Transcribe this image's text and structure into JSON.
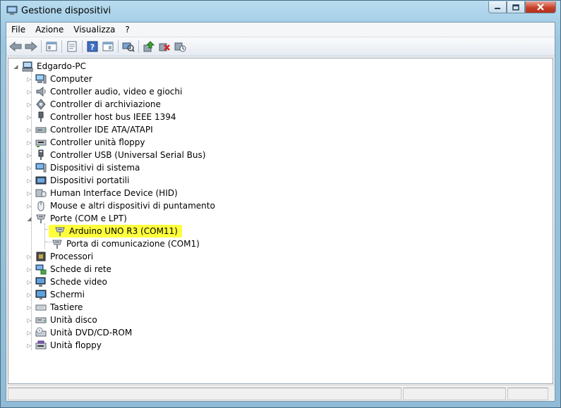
{
  "window": {
    "title": "Gestione dispositivi"
  },
  "menu": [
    "File",
    "Azione",
    "Visualizza",
    "?"
  ],
  "toolbar": [
    "back-icon",
    "forward-icon",
    "show-hide-console-tree-icon",
    "properties-icon",
    "help-icon",
    "show-action-pane-icon",
    "update-driver-icon",
    "uninstall-icon",
    "scan-hardware-icon"
  ],
  "tree": {
    "root": "Edgardo-PC",
    "items": [
      {
        "label": "Computer",
        "icon": "computer-icon",
        "expanded": false
      },
      {
        "label": "Controller audio, video e giochi",
        "icon": "speaker-icon",
        "expanded": false
      },
      {
        "label": "Controller di archiviazione",
        "icon": "storage-icon",
        "expanded": false
      },
      {
        "label": "Controller host bus IEEE 1394",
        "icon": "firewire-icon",
        "expanded": false
      },
      {
        "label": "Controller IDE ATA/ATAPI",
        "icon": "ide-icon",
        "expanded": false
      },
      {
        "label": "Controller unità floppy",
        "icon": "floppy-controller-icon",
        "expanded": false
      },
      {
        "label": "Controller USB (Universal Serial Bus)",
        "icon": "usb-icon",
        "expanded": false
      },
      {
        "label": "Dispositivi di sistema",
        "icon": "system-device-icon",
        "expanded": false
      },
      {
        "label": "Dispositivi portatili",
        "icon": "portable-device-icon",
        "expanded": false
      },
      {
        "label": "Human Interface Device (HID)",
        "icon": "hid-icon",
        "expanded": false
      },
      {
        "label": "Mouse e altri dispositivi di puntamento",
        "icon": "mouse-icon",
        "expanded": false
      },
      {
        "label": "Porte (COM e LPT)",
        "icon": "port-icon",
        "expanded": true,
        "children": [
          {
            "label": "Arduino UNO R3 (COM11)",
            "icon": "port-icon",
            "highlight": true
          },
          {
            "label": "Porta di comunicazione (COM1)",
            "icon": "port-icon",
            "highlight": false
          }
        ]
      },
      {
        "label": "Processori",
        "icon": "processor-icon",
        "expanded": false
      },
      {
        "label": "Schede di rete",
        "icon": "network-adapter-icon",
        "expanded": false
      },
      {
        "label": "Schede video",
        "icon": "display-adapter-icon",
        "expanded": false
      },
      {
        "label": "Schermi",
        "icon": "monitor-icon",
        "expanded": false
      },
      {
        "label": "Tastiere",
        "icon": "keyboard-icon",
        "expanded": false
      },
      {
        "label": "Unità disco",
        "icon": "disk-drive-icon",
        "expanded": false
      },
      {
        "label": "Unità DVD/CD-ROM",
        "icon": "dvd-icon",
        "expanded": false
      },
      {
        "label": "Unità floppy",
        "icon": "floppy-icon",
        "expanded": false
      }
    ]
  },
  "colors": {
    "highlight": "#ffff3c",
    "title_glass": "#a7d0e8",
    "close_button": "#c7422a"
  }
}
